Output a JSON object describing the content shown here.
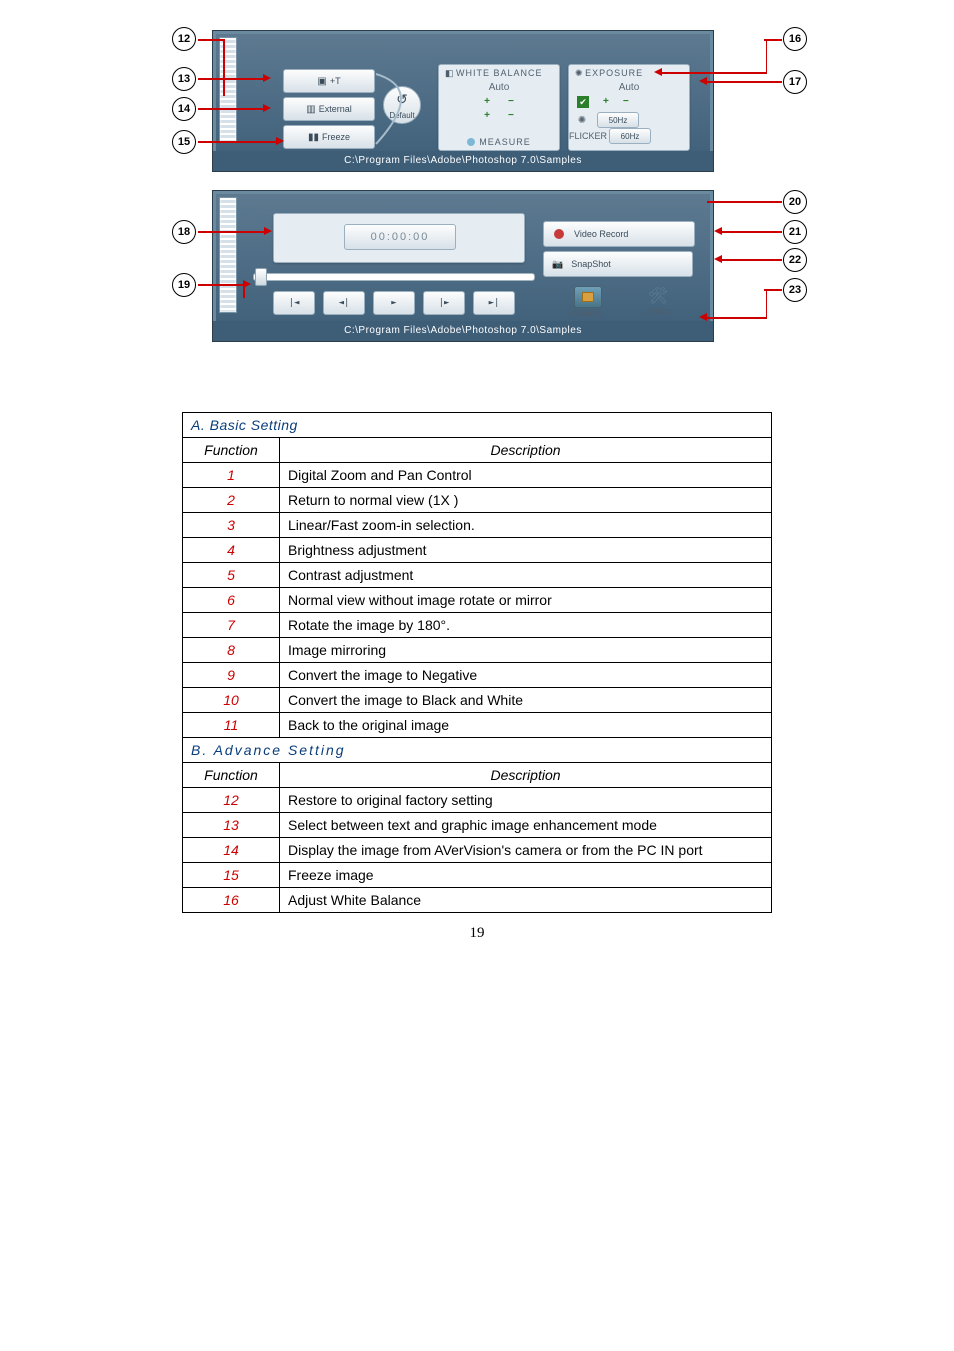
{
  "page_number": "19",
  "ui_top": {
    "path": "C:\\Program Files\\Adobe\\Photoshop 7.0\\Samples",
    "mode_button": "+T",
    "external_button": "External",
    "freeze_button": "Freeze",
    "default_button": "Default",
    "wb_title": "WHITE BALANCE",
    "wb_auto": "Auto",
    "measure": "MEASURE",
    "exp_title": "EXPOSURE",
    "exp_auto": "Auto",
    "flicker": "FLICKER",
    "hz50": "50Hz",
    "hz60": "60Hz"
  },
  "ui_bot": {
    "path": "C:\\Program Files\\Adobe\\Photoshop 7.0\\Samples",
    "timer": "00:00:00",
    "video_record": "Video Record",
    "snapshot": "SnapShot",
    "gallery": "Gallery",
    "setup": "Setup"
  },
  "callouts_top_left": [
    "12",
    "13",
    "14",
    "15"
  ],
  "callouts_top_right": [
    "16",
    "17"
  ],
  "callouts_bot_left": [
    "18",
    "19"
  ],
  "callouts_bot_right": [
    "20",
    "21",
    "22",
    "23"
  ],
  "tables": {
    "a_title": "A. Basic Setting",
    "b_title": "B. Advance Setting",
    "headers": {
      "function": "Function",
      "description": "Description"
    },
    "rows_a": [
      {
        "n": "1",
        "d": "Digital Zoom and Pan Control"
      },
      {
        "n": "2",
        "d": "Return to normal view (1X )"
      },
      {
        "n": "3",
        "d": "Linear/Fast zoom-in selection."
      },
      {
        "n": "4",
        "d": "Brightness adjustment"
      },
      {
        "n": "5",
        "d": "Contrast adjustment"
      },
      {
        "n": "6",
        "d": "Normal view without image rotate or mirror"
      },
      {
        "n": "7",
        "d": "Rotate the image by 180°."
      },
      {
        "n": "8",
        "d": "Image mirroring"
      },
      {
        "n": "9",
        "d": "Convert the image to Negative"
      },
      {
        "n": "10",
        "d": "Convert the image to Black and White"
      },
      {
        "n": "11",
        "d": "Back to the original image"
      }
    ],
    "rows_b": [
      {
        "n": "12",
        "d": "Restore to original factory setting"
      },
      {
        "n": "13",
        "d": "Select between text and graphic image enhancement mode"
      },
      {
        "n": "14",
        "d": "Display the image from AVerVision's camera or from the PC IN port"
      },
      {
        "n": "15",
        "d": "Freeze image"
      },
      {
        "n": "16",
        "d": "Adjust White Balance"
      }
    ]
  }
}
